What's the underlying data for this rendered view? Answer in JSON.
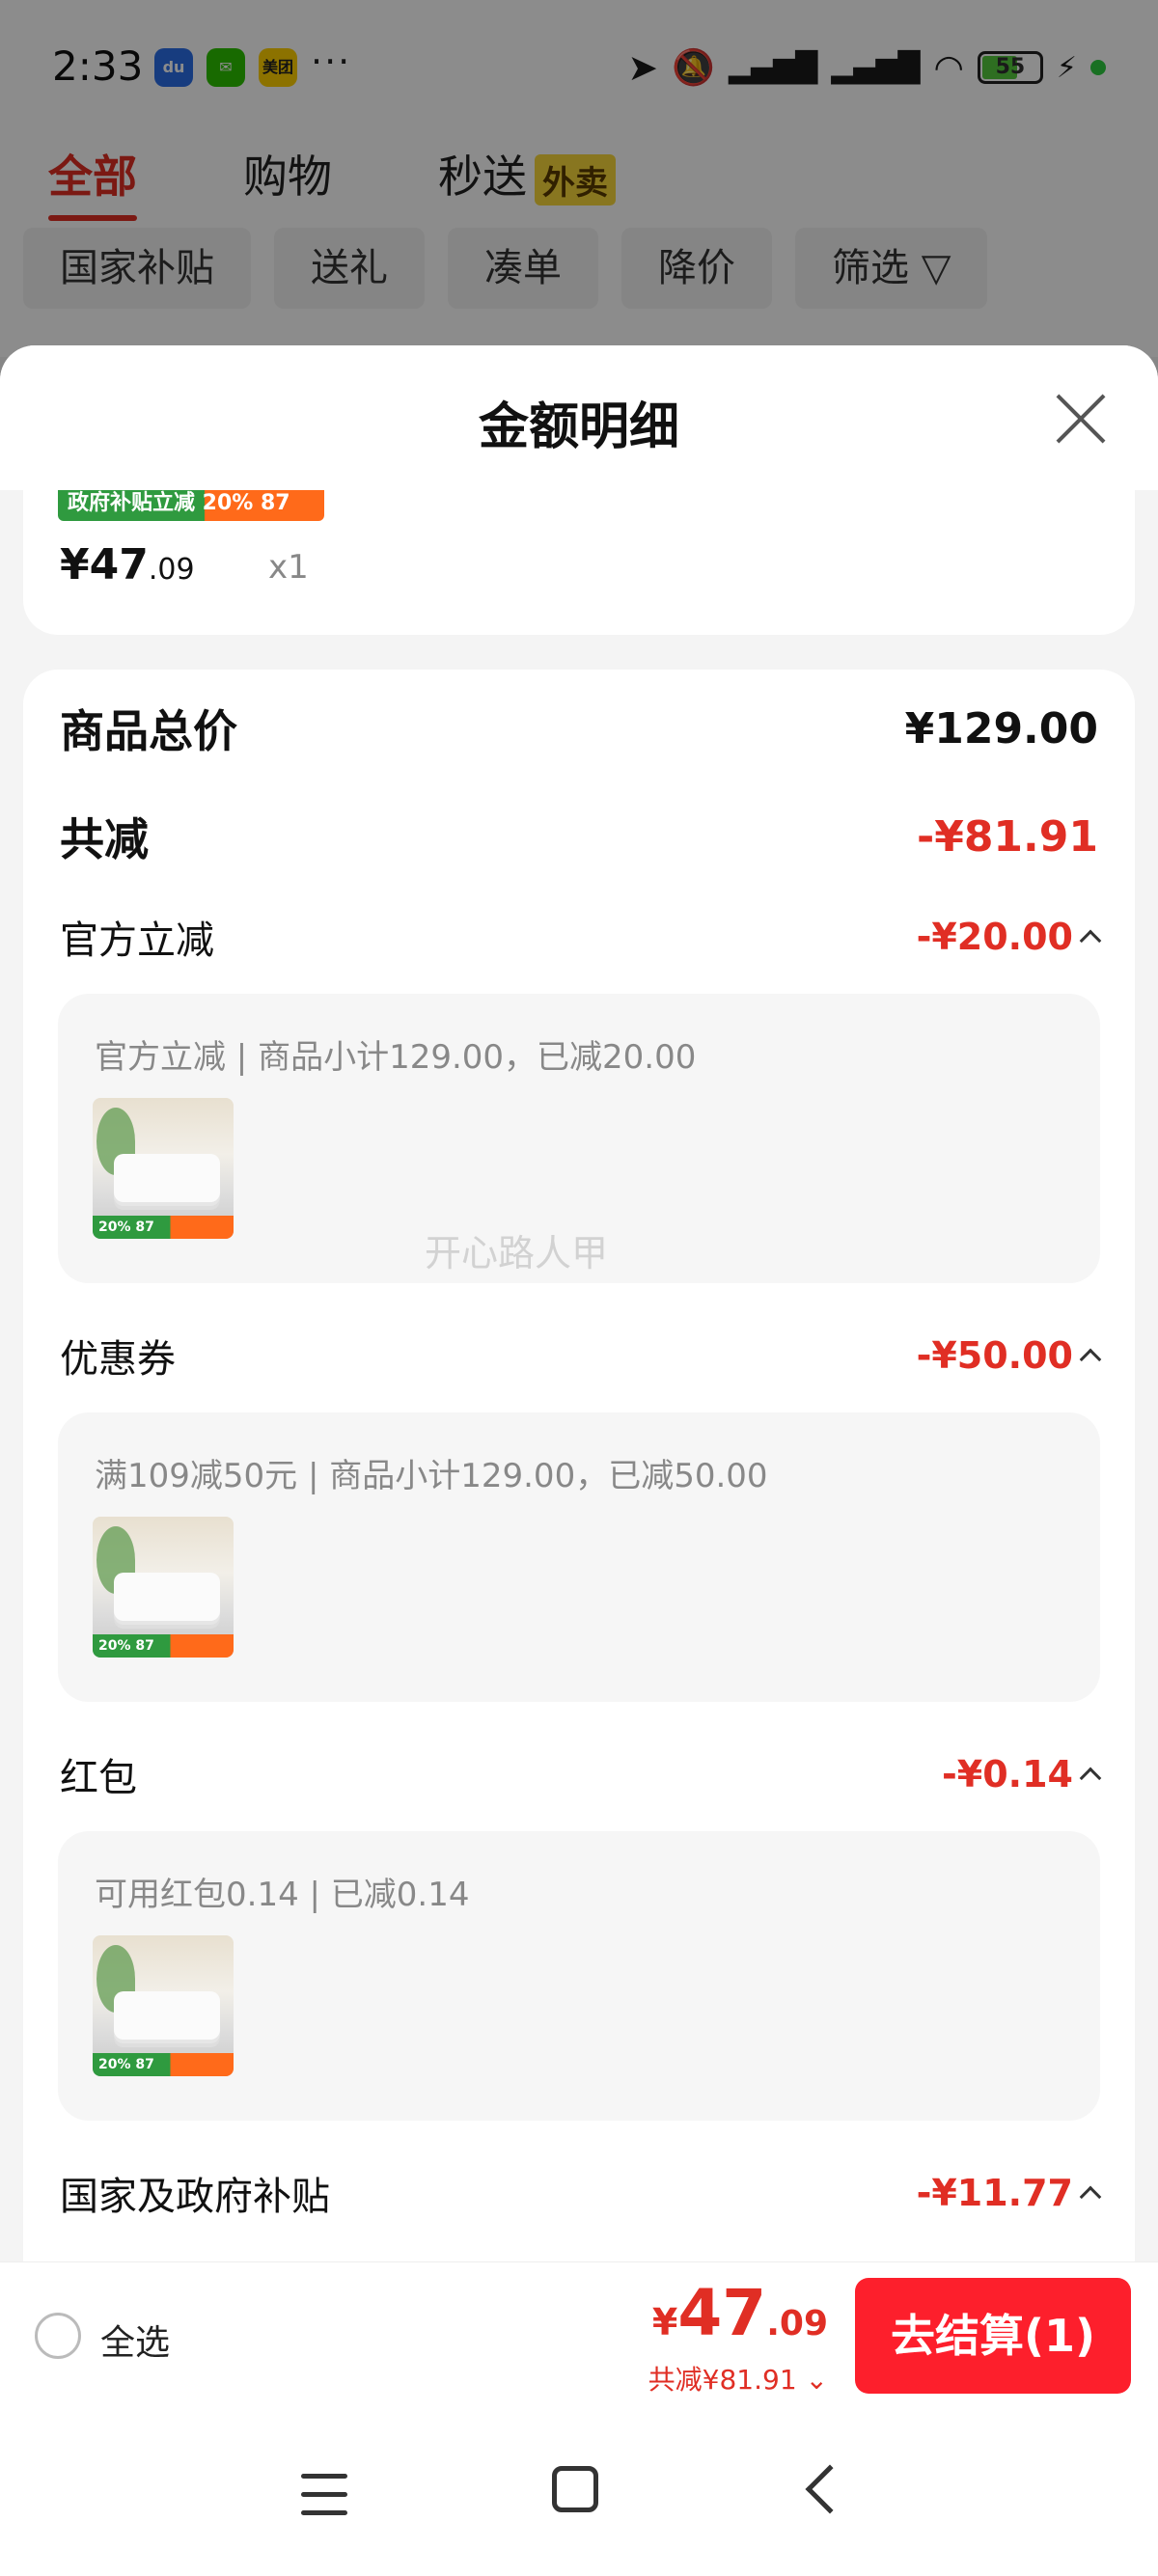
{
  "status": {
    "time": "2:33",
    "app_icons": [
      "baidu-icon",
      "wechat-icon",
      "meituan-icon"
    ],
    "meituan_label": "美团",
    "more": "···",
    "battery": "55"
  },
  "tabs": [
    {
      "label": "全部"
    },
    {
      "label": "购物"
    },
    {
      "label": "秒送",
      "tag": "外卖"
    }
  ],
  "filters": [
    "国家补贴",
    "送礼",
    "凑单",
    "降价",
    "筛选 ▽"
  ],
  "sheet": {
    "title": "金额明细",
    "item": {
      "banner": "政府补贴立减 20%  87",
      "price_int": "¥47",
      "price_dec": ".09",
      "qty": "x1"
    },
    "summary": {
      "total_label": "商品总价",
      "total_value": "¥129.00",
      "saved_label": "共减",
      "saved_value": "-¥81.91"
    },
    "discounts": [
      {
        "label": "官方立减",
        "value": "-¥20.00",
        "detail": "官方立减 | 商品小计129.00，已减20.00"
      },
      {
        "label": "优惠券",
        "value": "-¥50.00",
        "detail": "满109减50元 | 商品小计129.00，已减50.00"
      },
      {
        "label": "红包",
        "value": "-¥0.14",
        "detail": "可用红包0.14 | 已减0.14"
      },
      {
        "label": "国家及政府补贴",
        "value": "-¥11.77"
      }
    ],
    "product_thumb_band": "20% 87",
    "watermark": "开心路人甲"
  },
  "bottom": {
    "select_all": "全选",
    "currency": "¥",
    "total_int": "47",
    "total_dec": ".09",
    "saved": "共减¥81.91 ⌄",
    "checkout": "去结算(1)"
  },
  "colors": {
    "accent": "#e02e24",
    "checkout": "#fd1f2c"
  }
}
